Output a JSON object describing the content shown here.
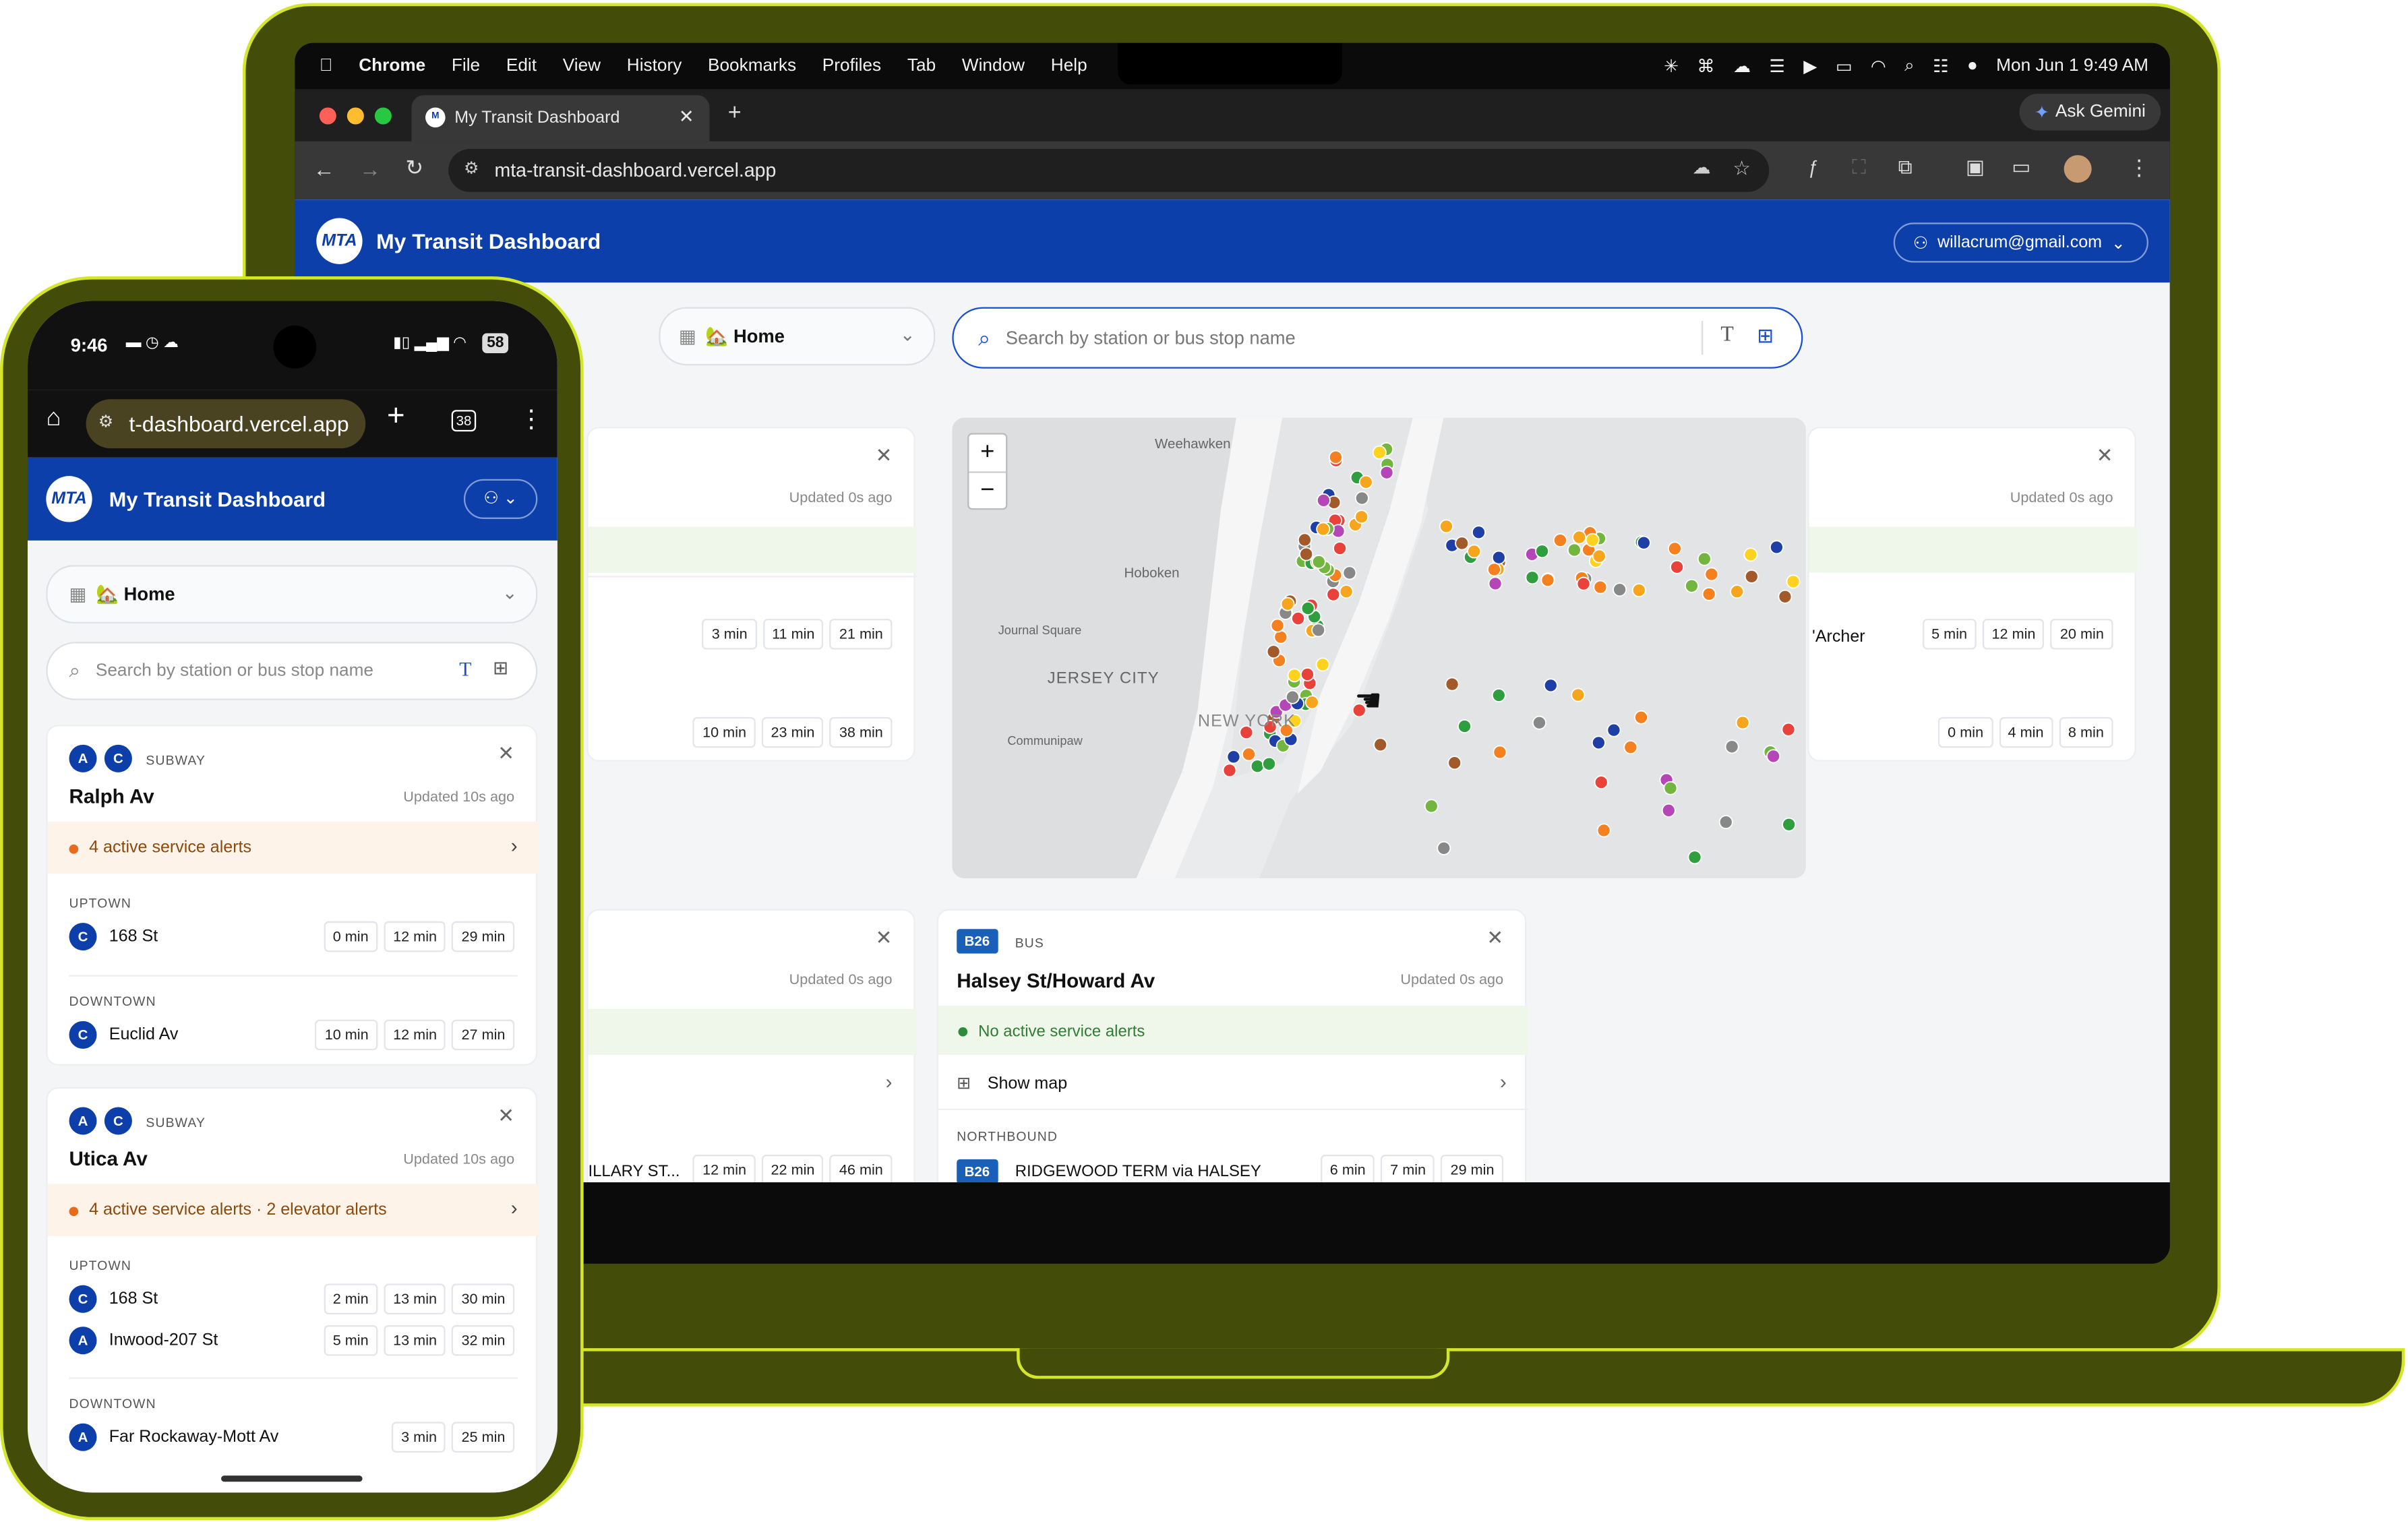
{
  "menubar": {
    "items": [
      "Chrome",
      "File",
      "Edit",
      "View",
      "History",
      "Bookmarks",
      "Profiles",
      "Tab",
      "Window",
      "Help"
    ],
    "clock": "Mon Jun 1  9:49 AM"
  },
  "browser": {
    "tab_title": "My Transit Dashboard",
    "url": "mta-transit-dashboard.vercel.app",
    "ask_gemini": "Ask Gemini"
  },
  "app": {
    "logo": "MTA",
    "title": "My Transit Dashboard",
    "account": "willacrum@gmail.com",
    "home_label": "🏡 Home",
    "search_placeholder": "Search by station or bus stop name"
  },
  "laptop_cards": {
    "left_top": {
      "updated": "Updated 0s ago",
      "times_row1": [
        "3 min",
        "11 min",
        "21 min"
      ],
      "times_row2": [
        "10 min",
        "23 min",
        "38 min"
      ]
    },
    "right_top": {
      "updated": "Updated 0s ago",
      "stop": "'Archer",
      "times_row1": [
        "5 min",
        "12 min",
        "20 min"
      ],
      "times_row2": [
        "0 min",
        "4 min",
        "8 min"
      ]
    },
    "left_bottom": {
      "updated": "Updated 0s ago",
      "stop": "ILLARY ST...",
      "times": [
        "12 min",
        "22 min",
        "46 min"
      ]
    },
    "bus": {
      "route": "B26",
      "type": "BUS",
      "name": "Halsey St/Howard Av",
      "updated": "Updated 0s ago",
      "alerts": "No active service alerts",
      "show_map": "Show map",
      "direction": "NORTHBOUND",
      "dest": "RIDGEWOOD TERM via HALSEY",
      "times": [
        "6 min",
        "7 min",
        "29 min"
      ]
    }
  },
  "map": {
    "labels": [
      "Weehawken",
      "Hoboken",
      "Journal Square",
      "JERSEY CITY",
      "NEW YORK",
      "Communipaw"
    ],
    "zoom_in": "+",
    "zoom_out": "−"
  },
  "phone": {
    "time": "9:46",
    "battery": "58",
    "url": "t-dashboard.vercel.app",
    "tabs": "38",
    "cards": [
      {
        "lines": [
          "A",
          "C"
        ],
        "type": "SUBWAY",
        "name": "Ralph Av",
        "updated": "Updated 10s ago",
        "alerts": "4 active service alerts",
        "groups": [
          {
            "dir": "UPTOWN",
            "rows": [
              {
                "line": "C",
                "dest": "168 St",
                "times": [
                  "0 min",
                  "12 min",
                  "29 min"
                ]
              }
            ]
          },
          {
            "dir": "DOWNTOWN",
            "rows": [
              {
                "line": "C",
                "dest": "Euclid Av",
                "times": [
                  "10 min",
                  "12 min",
                  "27 min"
                ]
              }
            ]
          }
        ]
      },
      {
        "lines": [
          "A",
          "C"
        ],
        "type": "SUBWAY",
        "name": "Utica Av",
        "updated": "Updated 10s ago",
        "alerts": "4 active service alerts · 2 elevator alerts",
        "groups": [
          {
            "dir": "UPTOWN",
            "rows": [
              {
                "line": "C",
                "dest": "168 St",
                "times": [
                  "2 min",
                  "13 min",
                  "30 min"
                ]
              },
              {
                "line": "A",
                "dest": "Inwood-207 St",
                "times": [
                  "5 min",
                  "13 min",
                  "32 min"
                ]
              }
            ]
          },
          {
            "dir": "DOWNTOWN",
            "rows": [
              {
                "line": "A",
                "dest": "Far Rockaway-Mott Av",
                "times": [
                  "3 min",
                  "25 min"
                ]
              }
            ]
          }
        ]
      }
    ]
  }
}
